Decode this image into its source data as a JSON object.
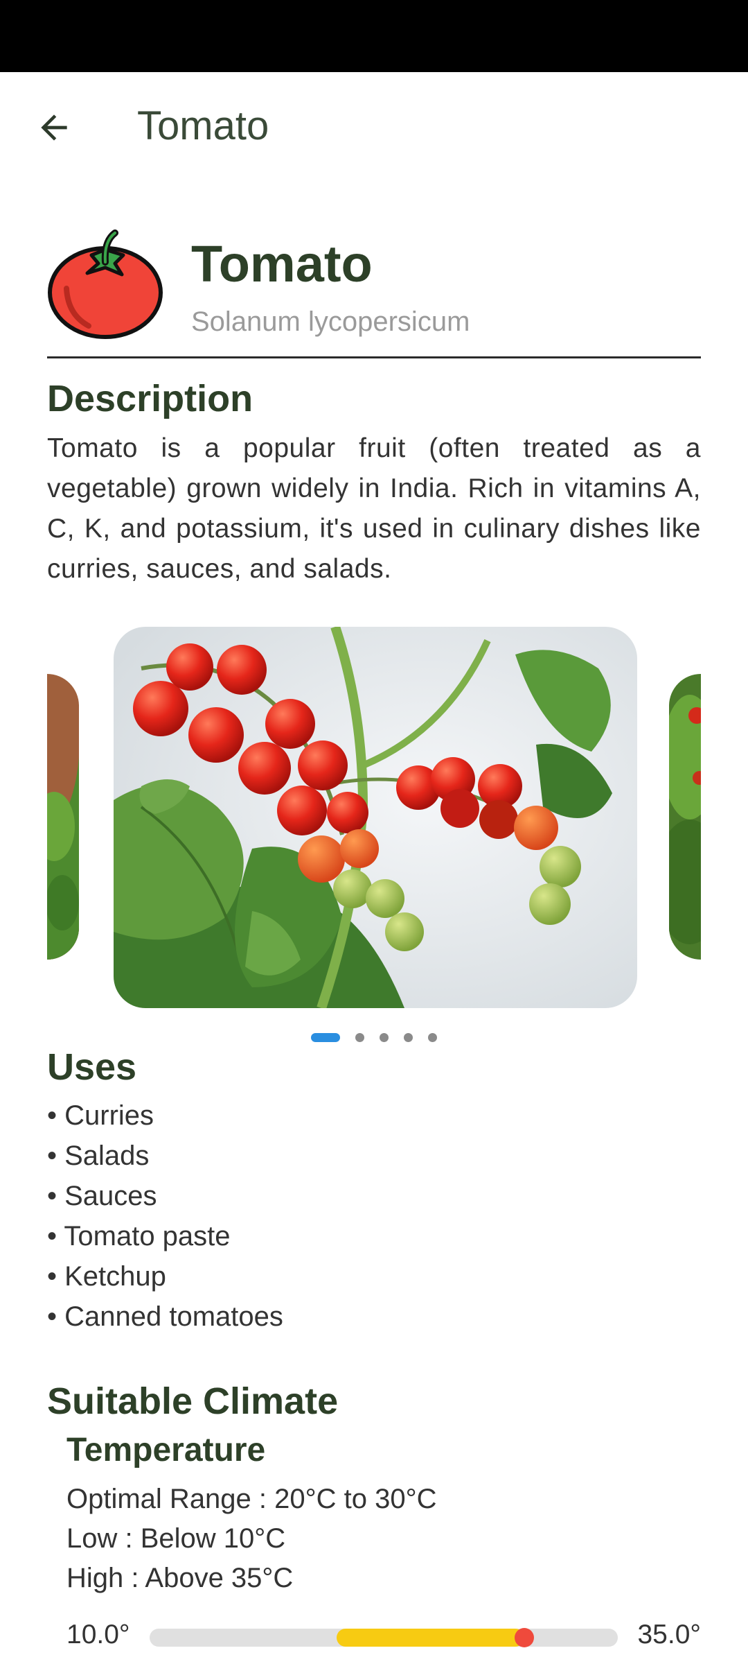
{
  "appbar": {
    "title": "Tomato"
  },
  "plant": {
    "name": "Tomato",
    "scientific_name": "Solanum lycopersicum"
  },
  "description": {
    "heading": "Description",
    "text": "Tomato is a popular fruit (often treated as a vegetable) grown widely in India. Rich in vitamins A, C, K, and potassium, it's used in culinary dishes like curries, sauces, and salads."
  },
  "carousel": {
    "slide_count": 5,
    "active_index": 0
  },
  "uses": {
    "heading": "Uses",
    "items": [
      "• Curries",
      "• Salads",
      "• Sauces",
      "• Tomato paste",
      "• Ketchup",
      "• Canned tomatoes"
    ]
  },
  "climate": {
    "heading": "Suitable Climate",
    "temperature": {
      "heading": "Temperature",
      "optimal": "Optimal Range : 20°C to 30°C",
      "low": "Low : Below 10°C",
      "high": "High : Above 35°C",
      "slider_min_label": "10.0°",
      "slider_max_label": "35.0°",
      "range_min": 10.0,
      "range_max": 35.0,
      "optimal_start": 20.0,
      "optimal_end": 30.0
    }
  },
  "colors": {
    "primary_text": "#2d4028",
    "indicator_active": "#2a8ee0",
    "slider_fill": "#f7cb12",
    "slider_thumb": "#ef4a3c"
  }
}
